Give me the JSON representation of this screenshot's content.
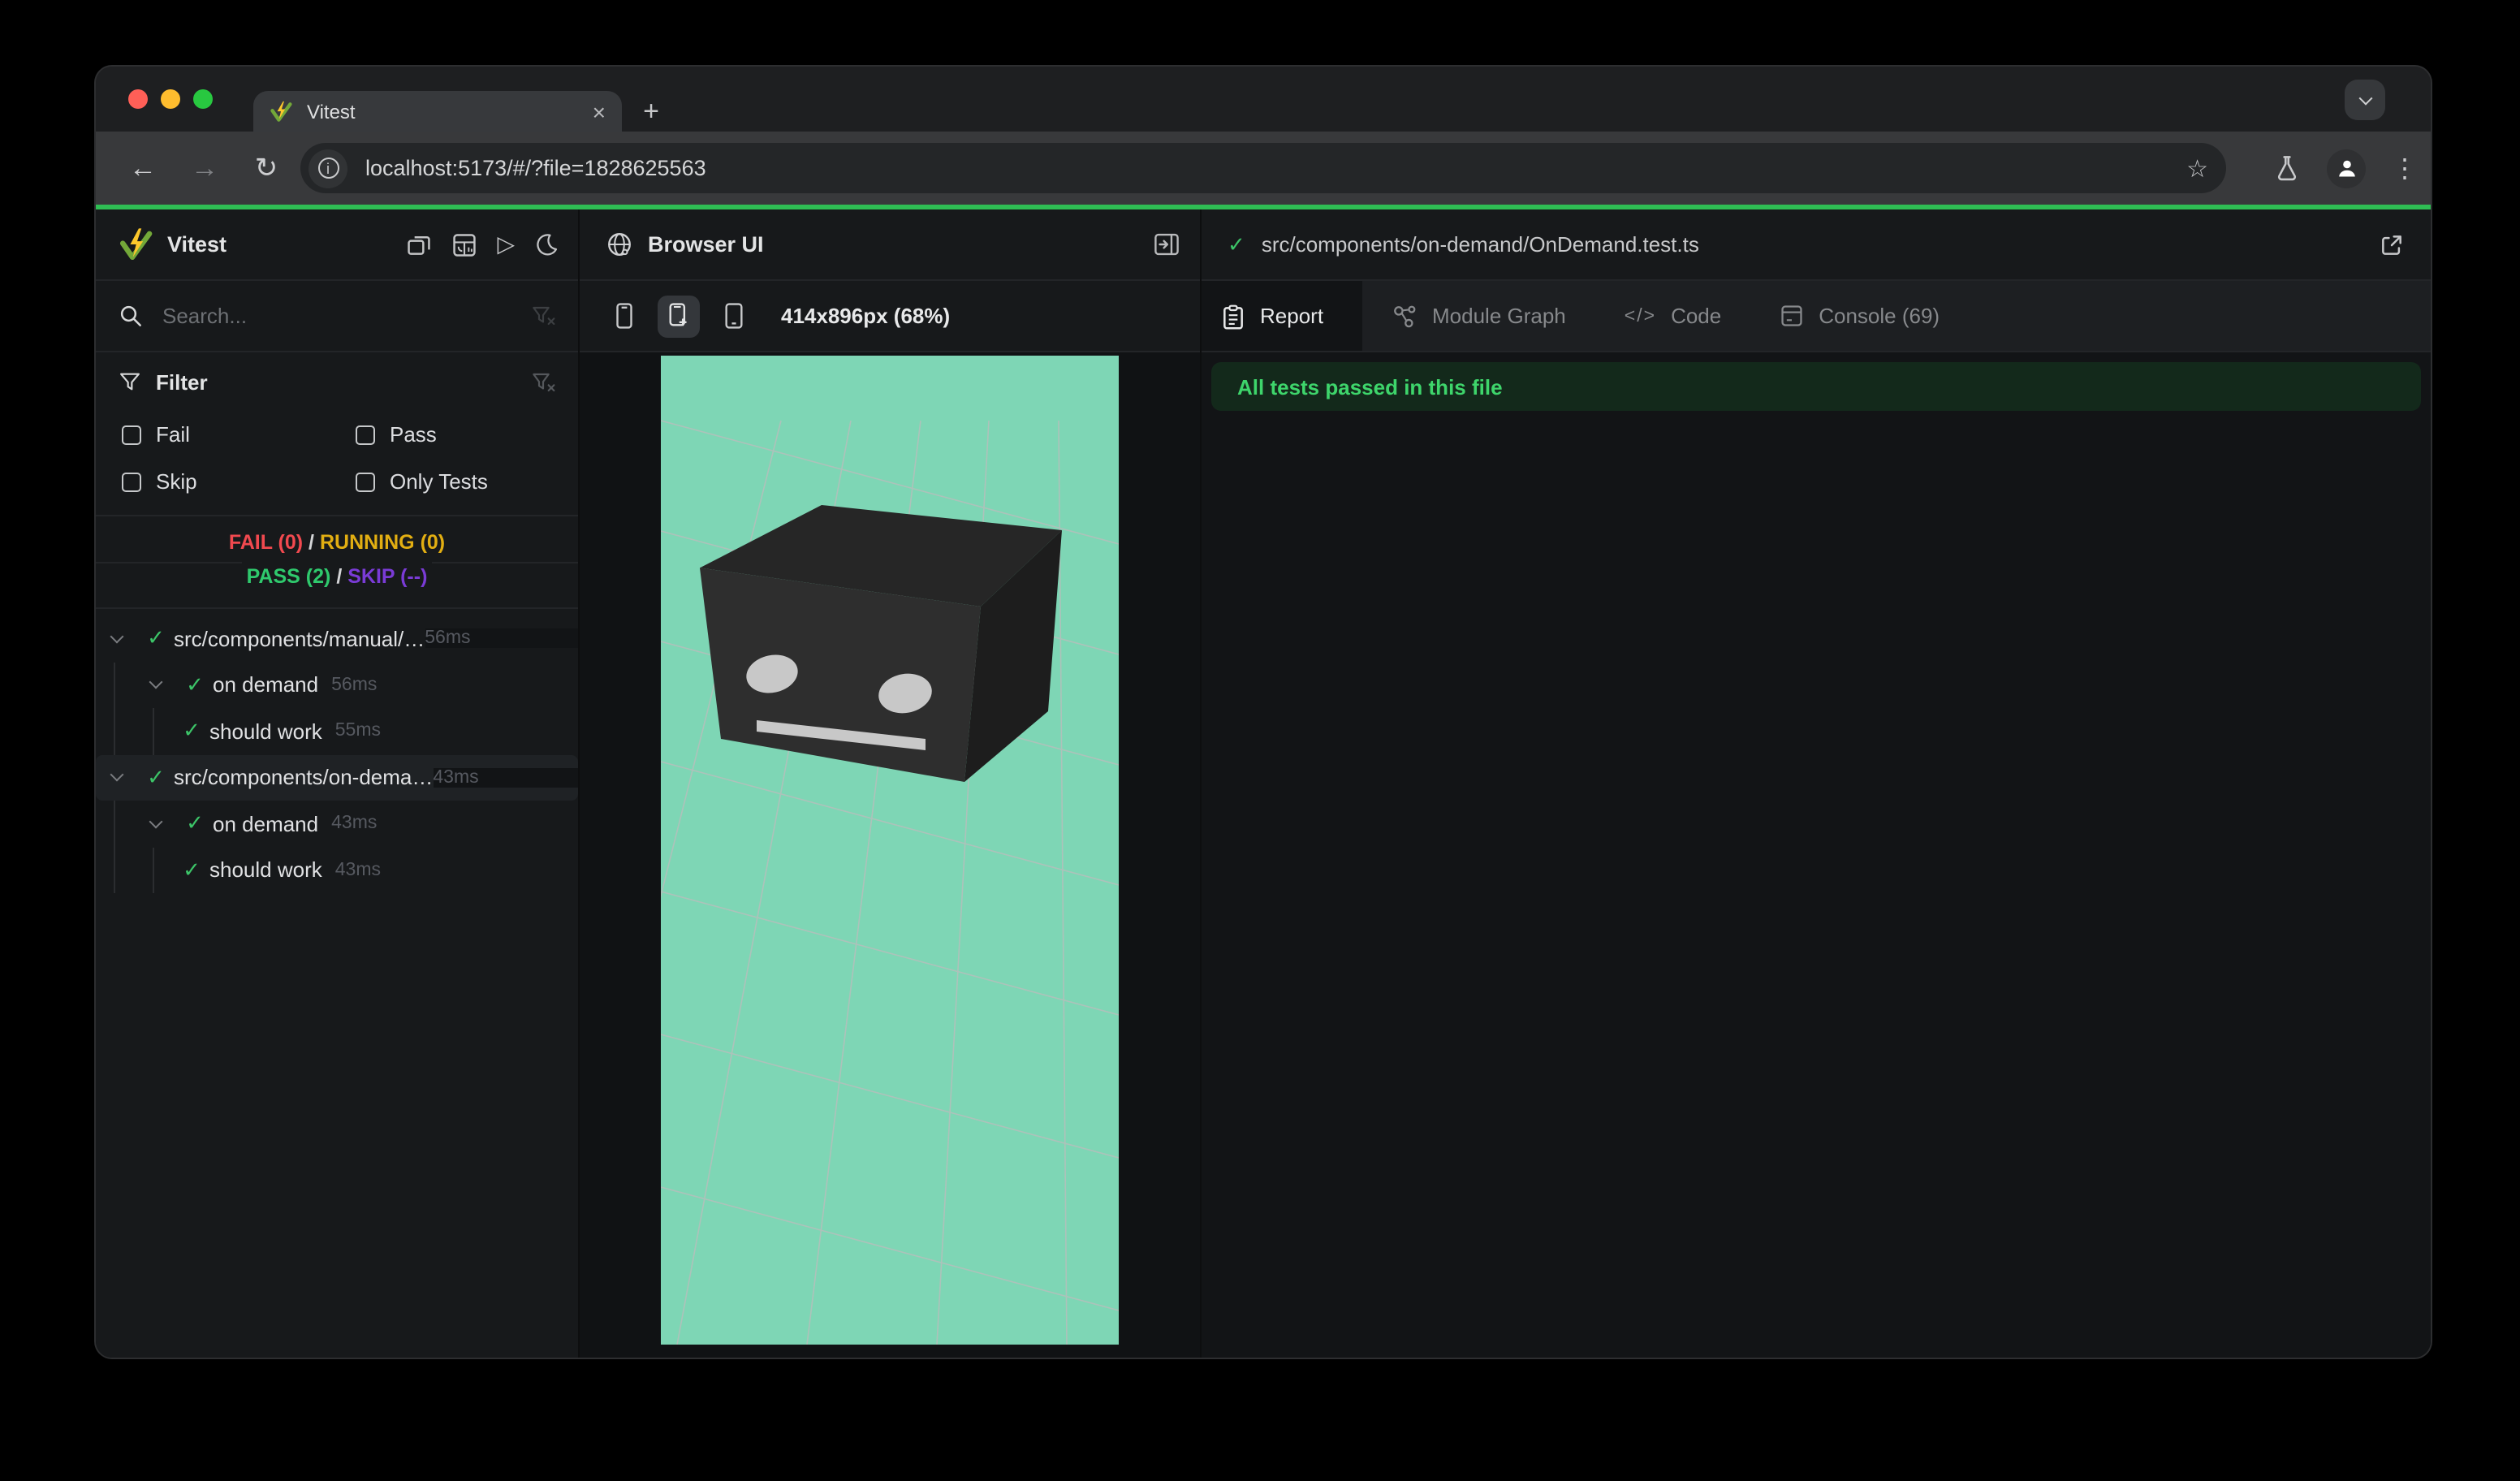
{
  "chrome": {
    "tab_title": "Vitest",
    "url": "localhost:5173/#/?file=1828625563",
    "close_glyph": "×",
    "new_tab_glyph": "+",
    "back_glyph": "←",
    "forward_glyph": "→",
    "reload_glyph": "↻",
    "info_glyph": "i",
    "star_glyph": "☆",
    "menu_glyph": "⋮"
  },
  "sidebar": {
    "title": "Vitest",
    "run_glyph": "▷",
    "search_placeholder": "Search...",
    "filter": {
      "label": "Filter",
      "options": [
        {
          "label": "Fail",
          "checked": false
        },
        {
          "label": "Pass",
          "checked": false
        },
        {
          "label": "Skip",
          "checked": false
        },
        {
          "label": "Only Tests",
          "checked": false
        }
      ]
    },
    "summary": {
      "fail": "FAIL (0)",
      "running": "RUNNING (0)",
      "pass": "PASS (2)",
      "skip": "SKIP (--)",
      "sep": "/"
    },
    "check_glyph": "✓",
    "tree": [
      {
        "label": "src/components/manual/…",
        "duration": "56ms",
        "level": 0,
        "selected": false
      },
      {
        "label": "on demand",
        "duration": "56ms",
        "level": 1,
        "selected": false
      },
      {
        "label": "should work",
        "duration": "55ms",
        "level": 2,
        "selected": false
      },
      {
        "label": "src/components/on-dema…",
        "duration": "43ms",
        "level": 0,
        "selected": true
      },
      {
        "label": "on demand",
        "duration": "43ms",
        "level": 1,
        "selected": false
      },
      {
        "label": "should work",
        "duration": "43ms",
        "level": 2,
        "selected": false
      }
    ]
  },
  "browser_panel": {
    "title": "Browser UI",
    "viewport_label": "414x896px (68%)"
  },
  "report_panel": {
    "file_check_glyph": "✓",
    "file_path": "src/components/on-demand/OnDemand.test.ts",
    "tabs": [
      {
        "label": "Report",
        "active": true
      },
      {
        "label": "Module Graph",
        "active": false
      },
      {
        "label": "Code",
        "active": false
      },
      {
        "label": "Console (69)",
        "active": false
      }
    ],
    "code_tab_glyph": "</>",
    "banner": "All tests passed in this file"
  },
  "scene": {
    "background": "#7ed6b5",
    "grid_color": "#b6bfbc",
    "cube_top": "#262626",
    "cube_front": "#2e2e2e",
    "cube_side": "#1d1d1d",
    "feature_color": "#c8c8c8"
  },
  "colors": {
    "progress_green": "#2fbe54",
    "pass_green": "#2fc96d",
    "fail_red": "#f1494f",
    "running_yellow": "#e2ae12",
    "skip_purple": "#7a3bd6",
    "banner_bg": "#13291b",
    "banner_text": "#3ed56b"
  }
}
